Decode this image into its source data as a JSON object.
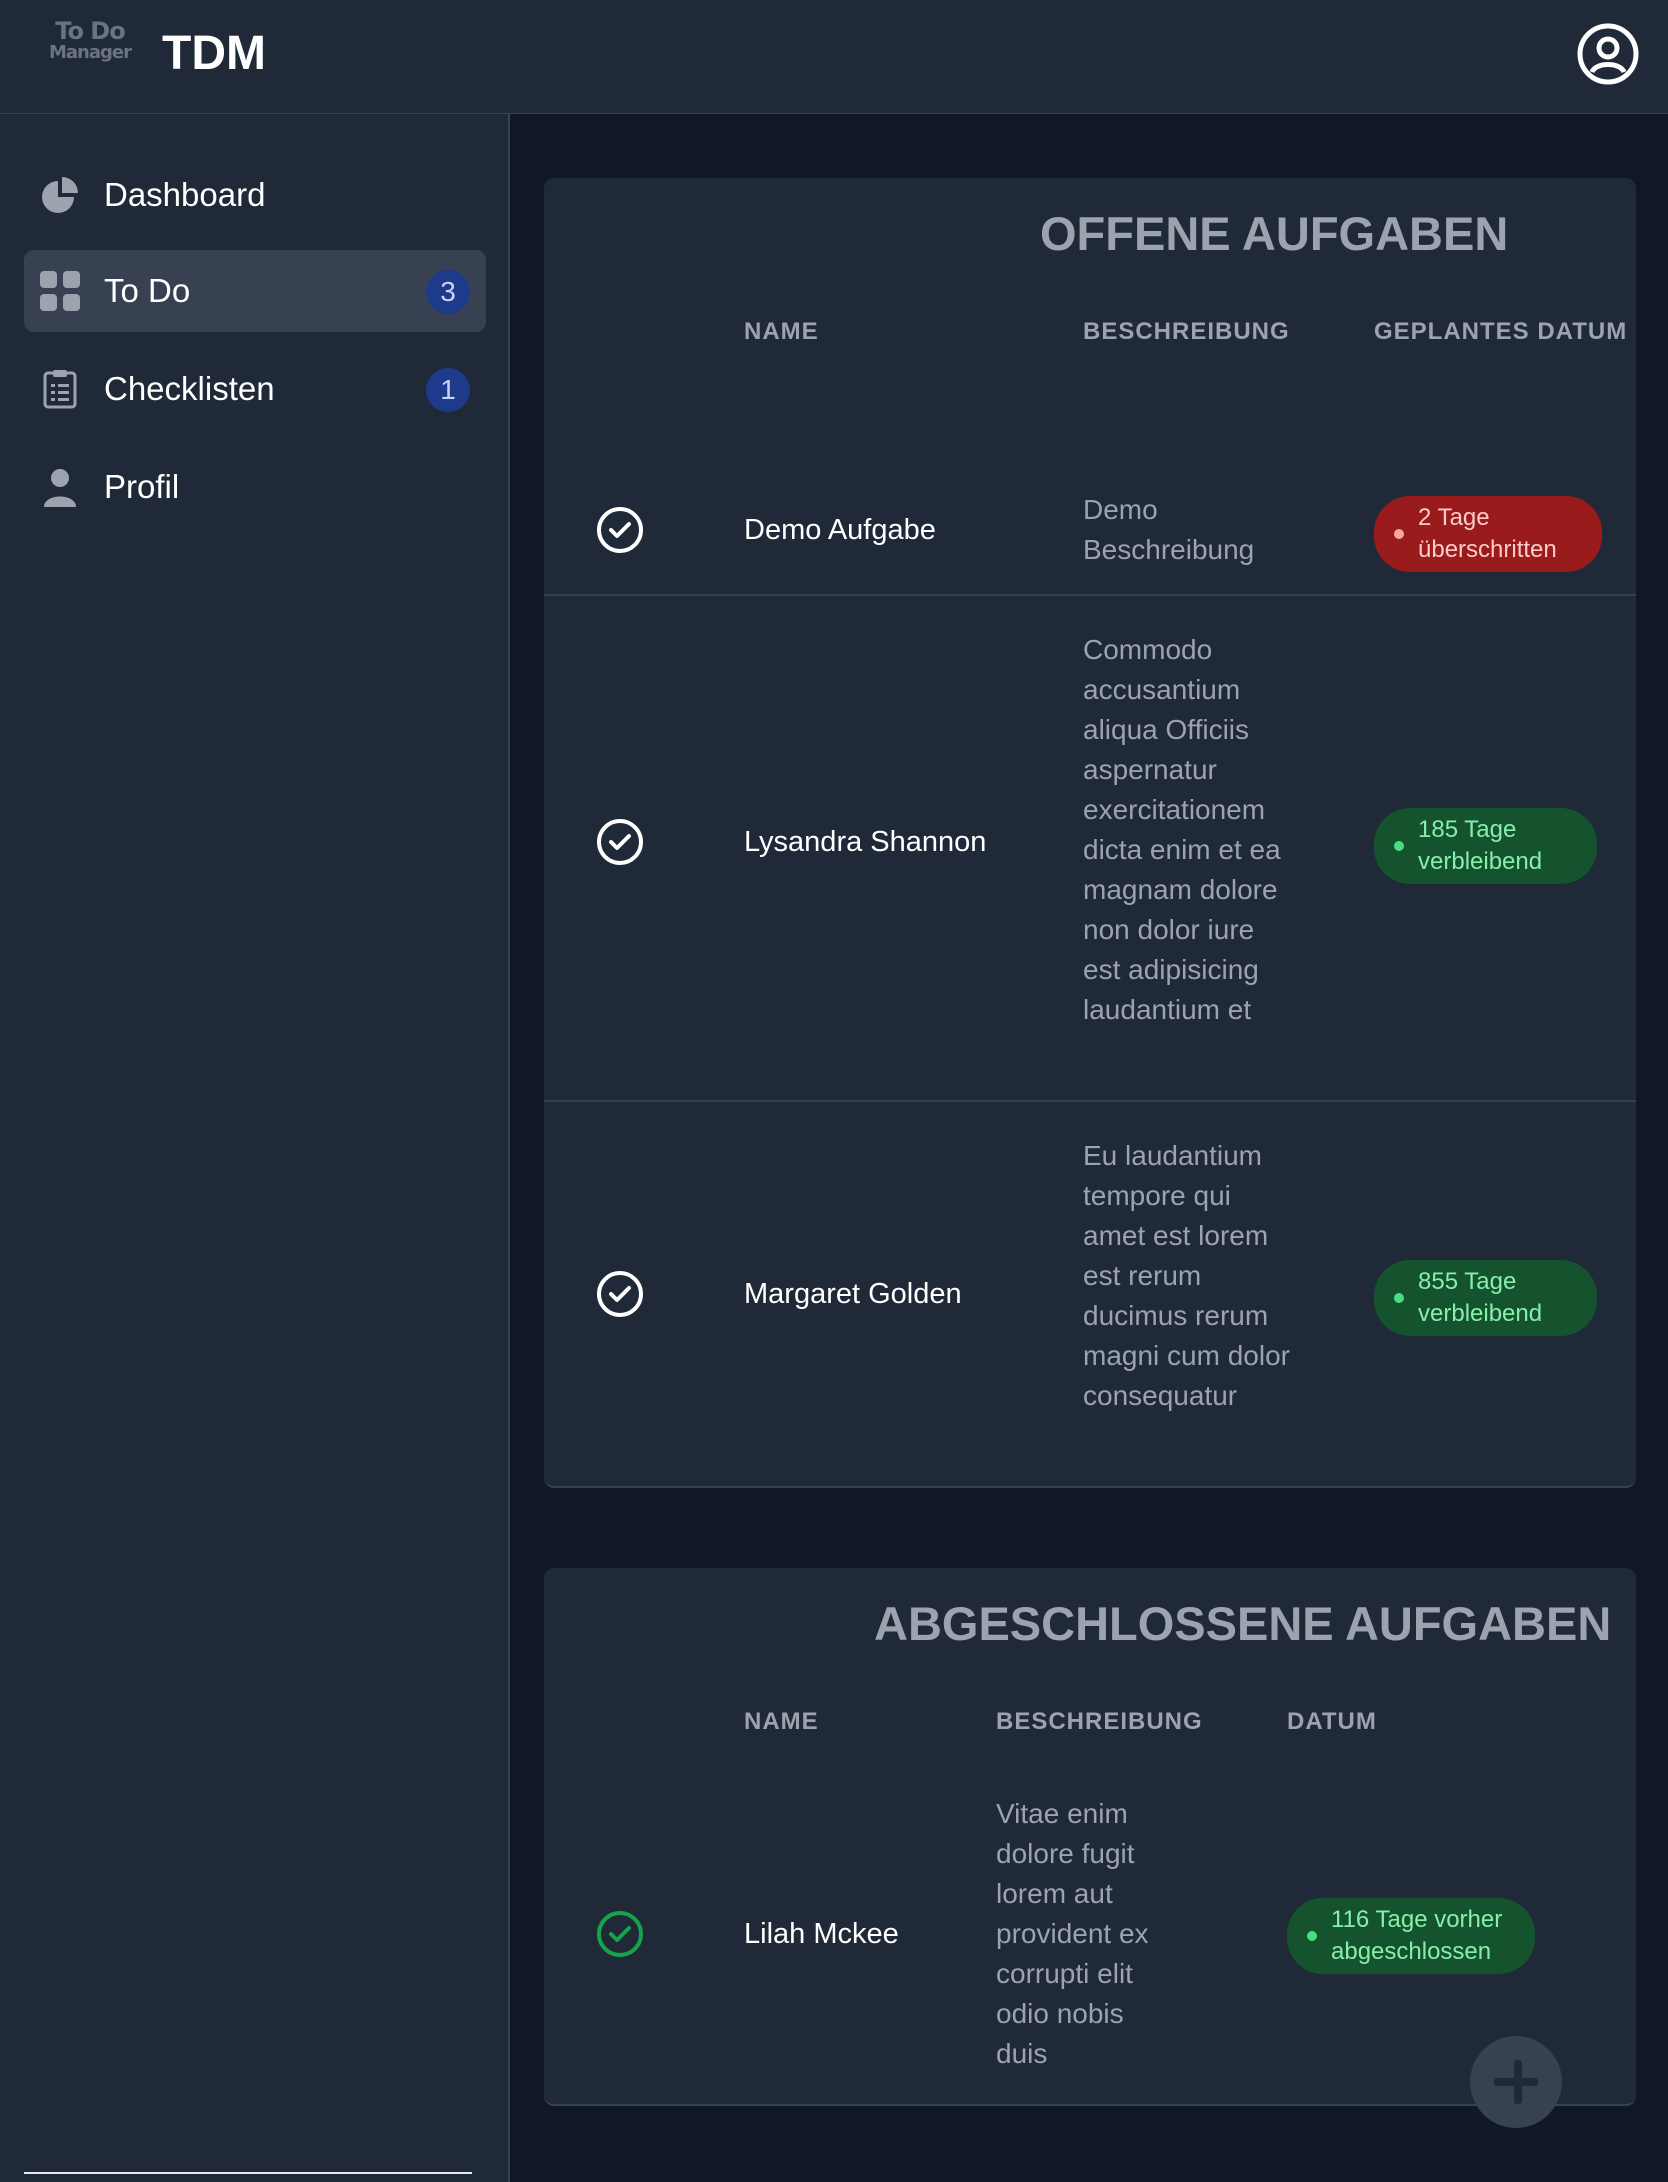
{
  "header": {
    "logo_line1": "To Do",
    "logo_line2": "Manager",
    "app_title": "TDM",
    "user_icon": "user-circle-icon"
  },
  "sidebar": {
    "items": [
      {
        "label": "Dashboard",
        "icon": "pie-chart-icon"
      },
      {
        "label": "To Do",
        "icon": "grid-icon",
        "badge": "3",
        "active": true
      },
      {
        "label": "Checklisten",
        "icon": "clipboard-list-icon",
        "badge": "1"
      },
      {
        "label": "Profil",
        "icon": "user-icon"
      }
    ]
  },
  "open_tasks": {
    "title": "OFFENE AUFGABEN",
    "columns": {
      "name": "NAME",
      "description": "BESCHREIBUNG",
      "date": "GEPLANTES DATUM"
    },
    "rows": [
      {
        "name": "Demo Aufgabe",
        "description": "Demo Beschreibung",
        "status": "2 Tage überschritten",
        "status_type": "overdue"
      },
      {
        "name": "Lysandra Shannon",
        "description": "Commodo accusantium aliqua Officiis aspernatur exercitationem dicta enim et ea magnam dolore non dolor iure est adipisicing laudantium et",
        "status": "185 Tage verbleibend",
        "status_type": "remaining"
      },
      {
        "name": "Margaret Golden",
        "description": "Eu laudantium tempore qui amet est lorem est rerum ducimus rerum magni cum dolor consequatur",
        "status": "855 Tage verbleibend",
        "status_type": "remaining"
      }
    ]
  },
  "completed_tasks": {
    "title": "ABGESCHLOSSENE AUFGABEN",
    "columns": {
      "name": "NAME",
      "description": "BESCHREIBUNG",
      "date": "DATUM"
    },
    "rows": [
      {
        "name": "Lilah Mckee",
        "description": "Vitae enim dolore fugit lorem aut provident ex corrupti elit odio nobis duis",
        "status": "116 Tage vorher abgeschlossen",
        "status_type": "completed"
      }
    ]
  },
  "colors": {
    "overdue": "#991b1b",
    "remaining": "#14532d",
    "completed_check": "#16a34a",
    "badge": "#1e3a8a"
  },
  "fab_icon": "plus-icon"
}
